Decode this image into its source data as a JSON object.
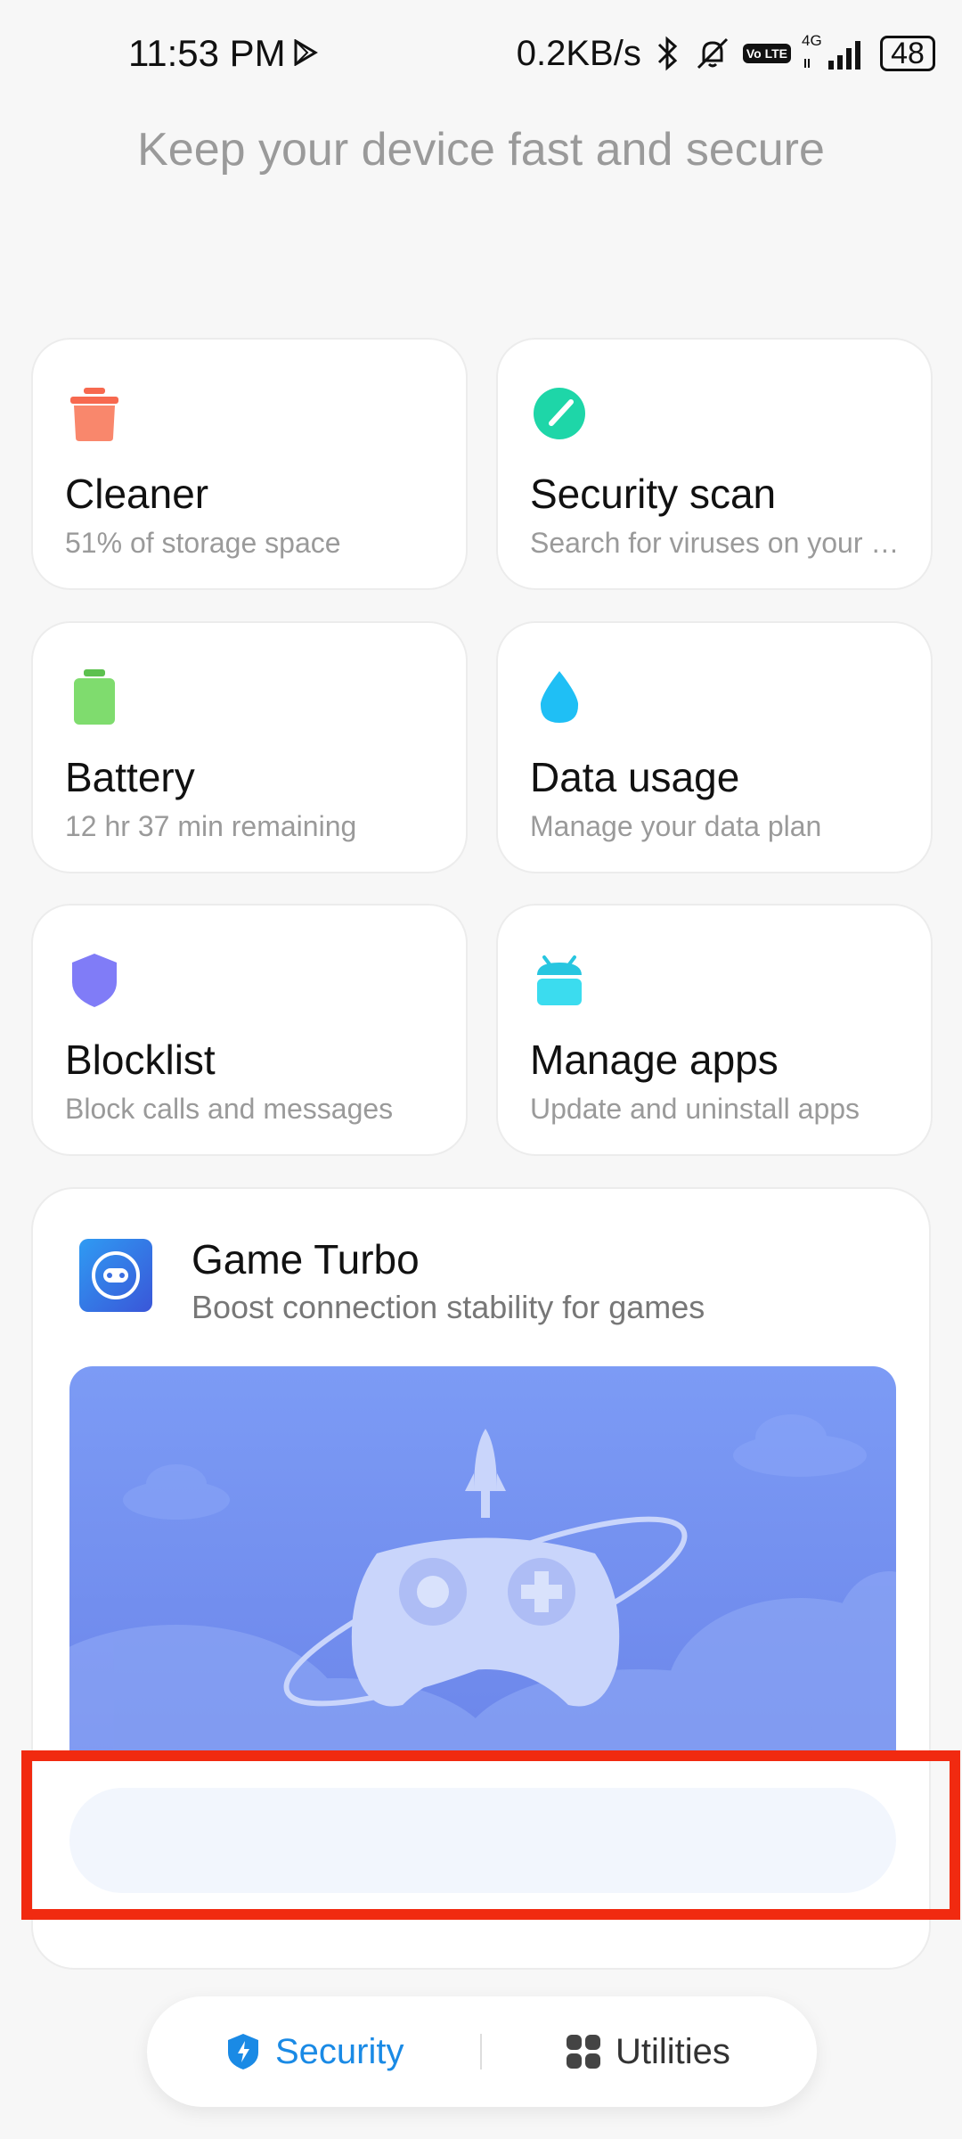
{
  "status_bar": {
    "time": "11:53 PM",
    "net_speed": "0.2KB/s",
    "network_type": "4G",
    "volte": "Vo LTE",
    "battery": "48"
  },
  "header": {
    "title": "Keep your device fast and secure"
  },
  "cards": [
    {
      "title": "Cleaner",
      "subtitle": "51% of storage space",
      "icon": "trash-icon",
      "color": "#f77a5c"
    },
    {
      "title": "Security scan",
      "subtitle": "Search for viruses on your device",
      "icon": "scan-icon",
      "color": "#1ed6a8"
    },
    {
      "title": "Battery",
      "subtitle": "12 hr 37 min  remaining",
      "icon": "battery-icon",
      "color": "#6fd45e"
    },
    {
      "title": "Data usage",
      "subtitle": "Manage your data plan",
      "icon": "water-drop-icon",
      "color": "#1fc3f5"
    },
    {
      "title": "Blocklist",
      "subtitle": "Block calls and messages",
      "icon": "shield-icon",
      "color": "#7e7bf5"
    },
    {
      "title": "Manage apps",
      "subtitle": "Update and uninstall apps",
      "icon": "android-icon",
      "color": "#31d3e8"
    }
  ],
  "game_turbo": {
    "title": "Game Turbo",
    "subtitle": "Boost connection stability for games",
    "button_label": ""
  },
  "bottom_nav": {
    "security_label": "Security",
    "utilities_label": "Utilities",
    "active": "Security",
    "active_color": "#1a8ae5"
  }
}
